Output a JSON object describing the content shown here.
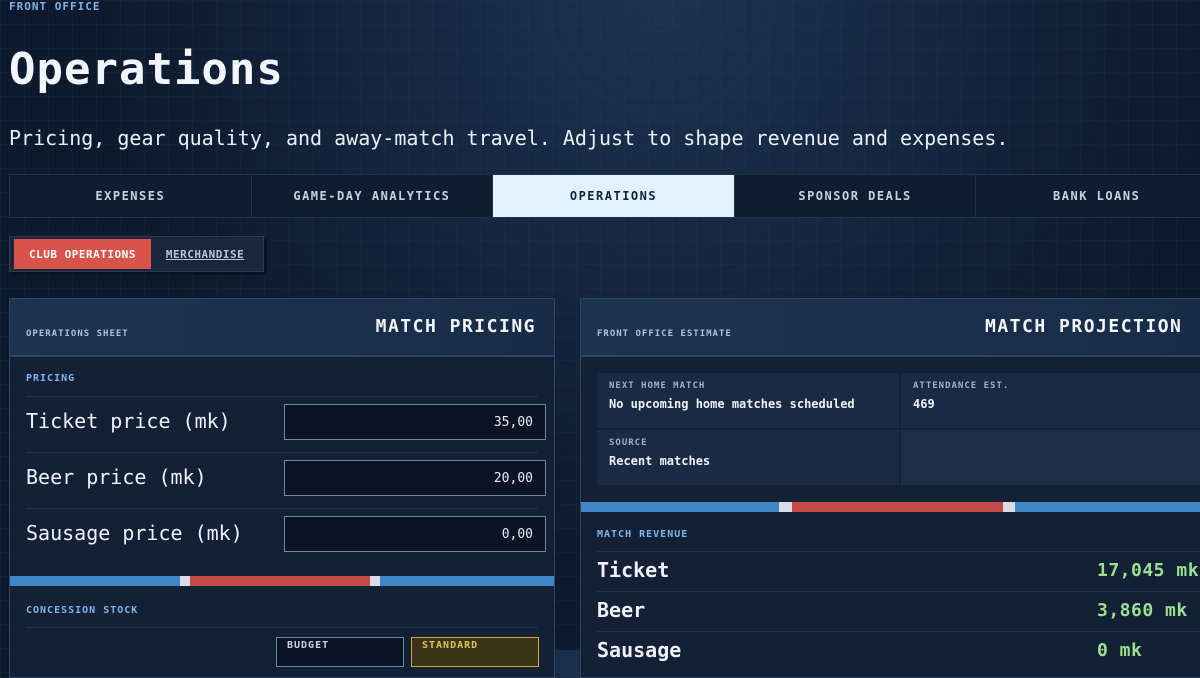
{
  "header": {
    "eyebrow": "FRONT OFFICE",
    "title": "Operations",
    "subtitle": "Pricing, gear quality, and away-match travel. Adjust to shape revenue and expenses."
  },
  "tabs": [
    {
      "label": "EXPENSES",
      "active": false
    },
    {
      "label": "GAME-DAY ANALYTICS",
      "active": false
    },
    {
      "label": "OPERATIONS",
      "active": true
    },
    {
      "label": "SPONSOR DEALS",
      "active": false
    },
    {
      "label": "BANK LOANS",
      "active": false
    }
  ],
  "subtabs": [
    {
      "label": "CLUB OPERATIONS",
      "active": true
    },
    {
      "label": "MERCHANDISE",
      "active": false
    }
  ],
  "pricing_panel": {
    "kicker": "OPERATIONS SHEET",
    "title": "MATCH PRICING",
    "section_label": "PRICING",
    "rows": [
      {
        "label": "Ticket price (mk)",
        "value": "35,00"
      },
      {
        "label": "Beer price (mk)",
        "value": "20,00"
      },
      {
        "label": "Sausage price (mk)",
        "value": "0,00"
      }
    ],
    "stock_label": "CONCESSION STOCK",
    "stock_options": [
      {
        "label": "BUDGET",
        "selected": false
      },
      {
        "label": "STANDARD",
        "selected": true
      }
    ]
  },
  "projection_panel": {
    "kicker": "FRONT OFFICE ESTIMATE",
    "title": "MATCH PROJECTION",
    "next_match_label": "NEXT HOME MATCH",
    "next_match_value": "No upcoming home matches scheduled",
    "attendance_label": "ATTENDANCE EST.",
    "attendance_value": "469",
    "source_label": "SOURCE",
    "source_value": "Recent matches",
    "revenue_label": "MATCH REVENUE",
    "revenue_rows": [
      {
        "label": "Ticket",
        "value": "17,045 mk"
      },
      {
        "label": "Beer",
        "value": "3,860 mk"
      },
      {
        "label": "Sausage",
        "value": "0 mk"
      }
    ]
  },
  "colors": {
    "accent_red": "#d9534a",
    "accent_blue": "#3e86c4",
    "positive_green": "#9be08e",
    "label_blue": "#7fb4e8",
    "active_tab_bg": "#e2f2fc"
  }
}
